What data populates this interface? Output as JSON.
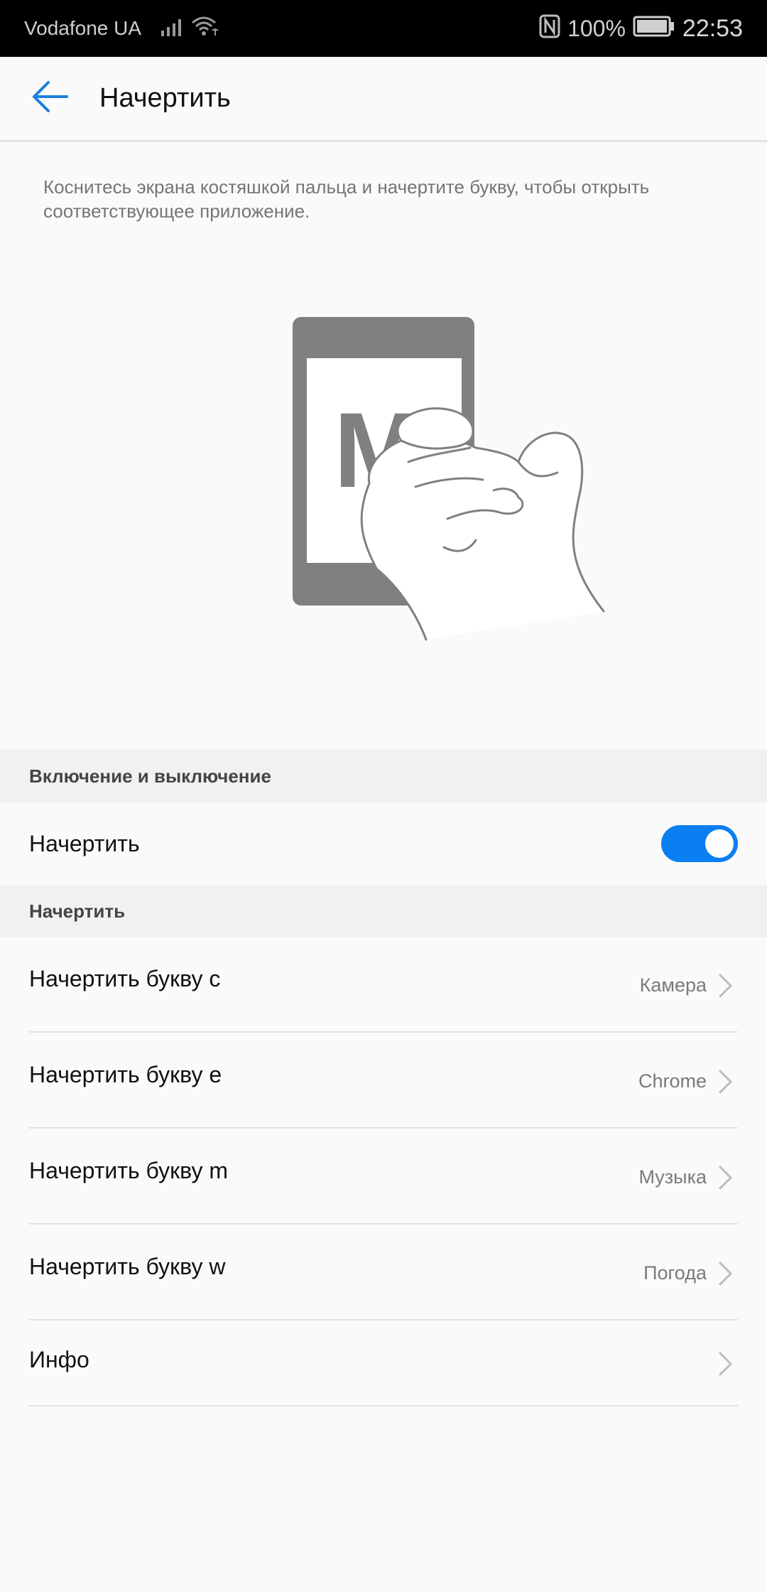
{
  "status_bar": {
    "carrier": "Vodafone UA",
    "battery_percent": "100%",
    "time": "22:53",
    "icons": [
      "signal-icon",
      "wifi-icon",
      "nfc-icon",
      "battery-icon"
    ]
  },
  "app_bar": {
    "back_icon": "arrow-left-icon",
    "title": "Начертить"
  },
  "description": "Коснитесь экрана костяшкой пальца и начертите букву, чтобы открыть соответствующее приложение.",
  "illustration": {
    "letter": "M"
  },
  "section_enable": {
    "header": "Включение и выключение",
    "toggle_label": "Начертить",
    "toggle_on": true,
    "accent_color": "#0a7ff2"
  },
  "section_draw": {
    "header": "Начертить",
    "items": [
      {
        "label": "Начертить букву c",
        "value": "Камера"
      },
      {
        "label": "Начертить букву e",
        "value": "Chrome"
      },
      {
        "label": "Начертить букву m",
        "value": "Музыка"
      },
      {
        "label": "Начертить букву w",
        "value": "Погода"
      },
      {
        "label": "Инфо",
        "value": ""
      }
    ]
  }
}
